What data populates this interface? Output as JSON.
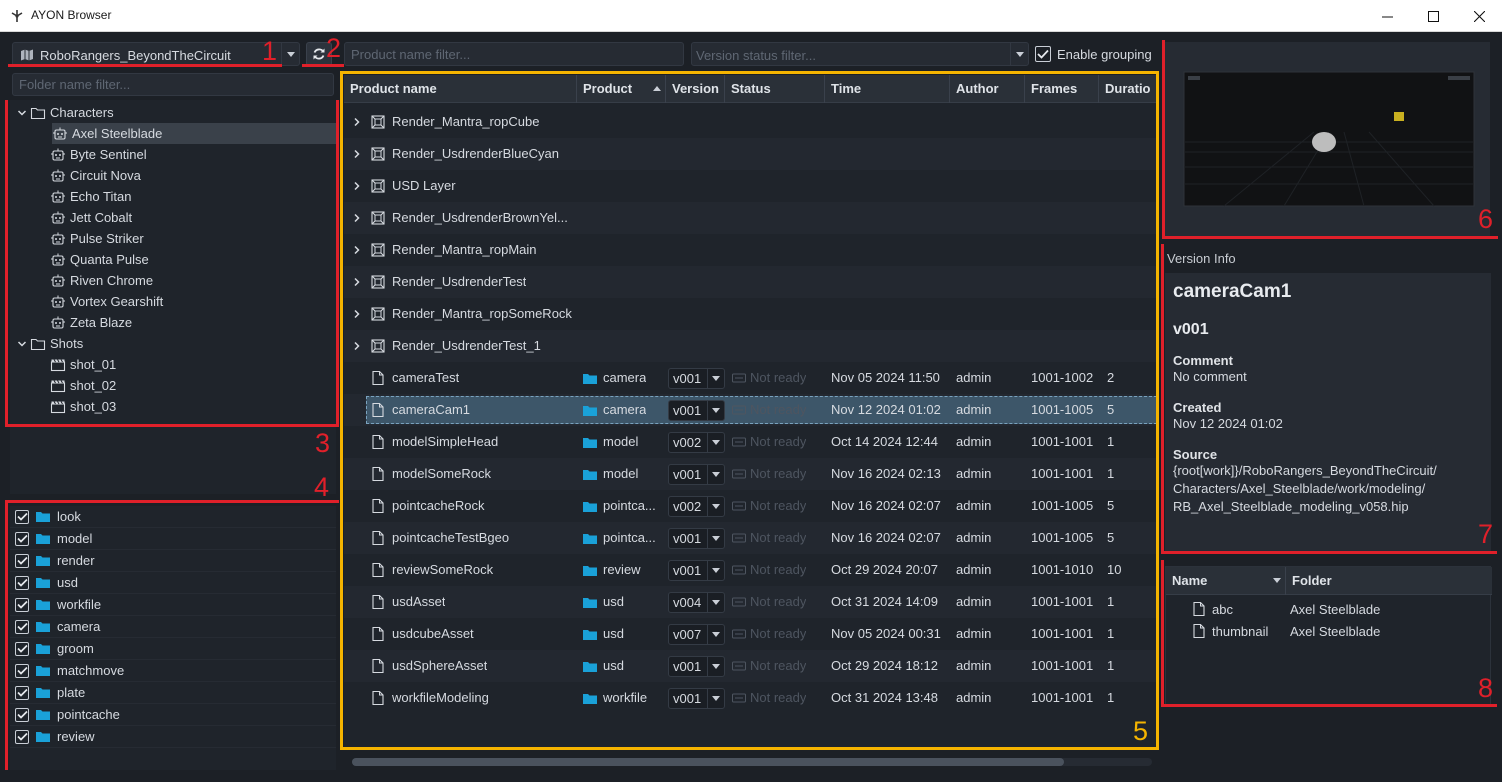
{
  "window": {
    "title": "AYON Browser"
  },
  "toolbar": {
    "project": "RoboRangers_BeyondTheCircuit",
    "product_filter_placeholder": "Product name filter...",
    "status_filter_placeholder": "Version status filter...",
    "grouping_label": "Enable grouping"
  },
  "folders": {
    "filter_placeholder": "Folder name filter...",
    "tree": [
      {
        "label": "Characters",
        "level": 0,
        "type": "folder",
        "expanded": true
      },
      {
        "label": "Axel Steelblade",
        "level": 1,
        "type": "robot",
        "selected": true
      },
      {
        "label": "Byte Sentinel",
        "level": 1,
        "type": "robot"
      },
      {
        "label": "Circuit Nova",
        "level": 1,
        "type": "robot"
      },
      {
        "label": "Echo Titan",
        "level": 1,
        "type": "robot"
      },
      {
        "label": "Jett Cobalt",
        "level": 1,
        "type": "robot"
      },
      {
        "label": "Pulse Striker",
        "level": 1,
        "type": "robot"
      },
      {
        "label": "Quanta Pulse",
        "level": 1,
        "type": "robot"
      },
      {
        "label": "Riven Chrome",
        "level": 1,
        "type": "robot"
      },
      {
        "label": "Vortex Gearshift",
        "level": 1,
        "type": "robot"
      },
      {
        "label": "Zeta Blaze",
        "level": 1,
        "type": "robot"
      },
      {
        "label": "Shots",
        "level": 0,
        "type": "folder",
        "expanded": true
      },
      {
        "label": "shot_01",
        "level": 1,
        "type": "clapper"
      },
      {
        "label": "shot_02",
        "level": 1,
        "type": "clapper"
      },
      {
        "label": "shot_03",
        "level": 1,
        "type": "clapper"
      }
    ]
  },
  "product_types": [
    "look",
    "model",
    "render",
    "usd",
    "workfile",
    "camera",
    "groom",
    "matchmove",
    "plate",
    "pointcache",
    "review"
  ],
  "products": {
    "columns": [
      "Product name",
      "Product",
      "Version",
      "Status",
      "Time",
      "Author",
      "Frames",
      "Duratio"
    ],
    "groups": [
      "Render_Mantra_ropCube",
      "Render_UsdrenderBlueCyan",
      "USD Layer",
      "Render_UsdrenderBrownYel...",
      "Render_Mantra_ropMain",
      "Render_UsdrenderTest",
      "Render_Mantra_ropSomeRock",
      "Render_UsdrenderTest_1"
    ],
    "rows": [
      {
        "name": "cameraTest",
        "product": "camera",
        "version": "v001",
        "status": "Not ready",
        "time": "Nov 05 2024 11:50",
        "author": "admin",
        "frames": "1001-1002",
        "duration": "2"
      },
      {
        "name": "cameraCam1",
        "product": "camera",
        "version": "v001",
        "status": "Not ready",
        "time": "Nov 12 2024 01:02",
        "author": "admin",
        "frames": "1001-1005",
        "duration": "5",
        "selected": true
      },
      {
        "name": "modelSimpleHead",
        "product": "model",
        "version": "v002",
        "status": "Not ready",
        "time": "Oct 14 2024 12:44",
        "author": "admin",
        "frames": "1001-1001",
        "duration": "1"
      },
      {
        "name": "modelSomeRock",
        "product": "model",
        "version": "v001",
        "status": "Not ready",
        "time": "Nov 16 2024 02:13",
        "author": "admin",
        "frames": "1001-1001",
        "duration": "1"
      },
      {
        "name": "pointcacheRock",
        "product": "pointca...",
        "version": "v002",
        "status": "Not ready",
        "time": "Nov 16 2024 02:07",
        "author": "admin",
        "frames": "1001-1005",
        "duration": "5"
      },
      {
        "name": "pointcacheTestBgeo",
        "product": "pointca...",
        "version": "v001",
        "status": "Not ready",
        "time": "Nov 16 2024 02:07",
        "author": "admin",
        "frames": "1001-1005",
        "duration": "5"
      },
      {
        "name": "reviewSomeRock",
        "product": "review",
        "version": "v001",
        "status": "Not ready",
        "time": "Oct 29 2024 20:07",
        "author": "admin",
        "frames": "1001-1010",
        "duration": "10"
      },
      {
        "name": "usdAsset",
        "product": "usd",
        "version": "v004",
        "status": "Not ready",
        "time": "Oct 31 2024 14:09",
        "author": "admin",
        "frames": "1001-1001",
        "duration": "1"
      },
      {
        "name": "usdcubeAsset",
        "product": "usd",
        "version": "v007",
        "status": "Not ready",
        "time": "Nov 05 2024 00:31",
        "author": "admin",
        "frames": "1001-1001",
        "duration": "1"
      },
      {
        "name": "usdSphereAsset",
        "product": "usd",
        "version": "v001",
        "status": "Not ready",
        "time": "Oct 29 2024 18:12",
        "author": "admin",
        "frames": "1001-1001",
        "duration": "1"
      },
      {
        "name": "workfileModeling",
        "product": "workfile",
        "version": "v001",
        "status": "Not ready",
        "time": "Oct 31 2024 13:48",
        "author": "admin",
        "frames": "1001-1001",
        "duration": "1"
      }
    ]
  },
  "version_info": {
    "section_label": "Version Info",
    "product_name": "cameraCam1",
    "version": "v001",
    "comment_label": "Comment",
    "comment": "No comment",
    "created_label": "Created",
    "created": "Nov 12 2024 01:02",
    "source_label": "Source",
    "source_lines": [
      "{root[work]}/RoboRangers_BeyondTheCircuit/",
      "Characters/Axel_Steelblade/work/modeling/",
      "RB_Axel_Steelblade_modeling_v058.hip"
    ]
  },
  "representations": {
    "columns": [
      "Name",
      "Folder"
    ],
    "rows": [
      {
        "name": "abc",
        "folder": "Axel Steelblade"
      },
      {
        "name": "thumbnail",
        "folder": "Axel Steelblade"
      }
    ]
  },
  "annotations": [
    "1",
    "2",
    "3",
    "4",
    "5",
    "6",
    "7",
    "8"
  ],
  "colors": {
    "annotation_red": "#e0202a",
    "highlight_yellow": "#f5b400",
    "folder_blue": "#1aa1d8",
    "selection": "#3d5669"
  }
}
